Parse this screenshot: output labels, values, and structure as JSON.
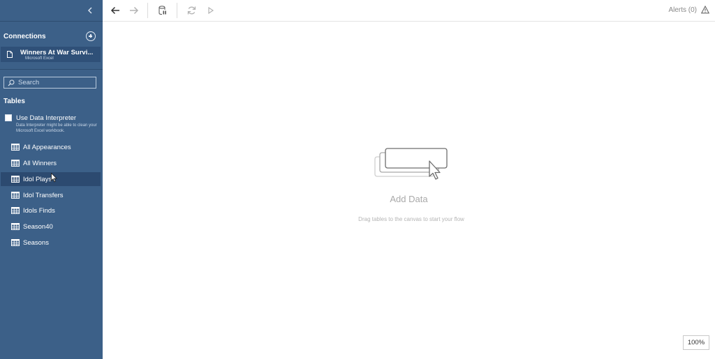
{
  "sidebar": {
    "collapse_icon": "chevron-left-icon",
    "connections_title": "Connections",
    "add_connection_icon": "plus-circle-icon",
    "connection": {
      "name": "Winners At War Survi...",
      "type": "Microsoft Excel"
    },
    "search": {
      "placeholder": "Search"
    },
    "tables_title": "Tables",
    "data_interpreter": {
      "label": "Use Data Interpreter",
      "checked": false,
      "hint": "Data Interpreter might be able to clean your Microsoft Excel workbook."
    },
    "tables": [
      {
        "label": "All Appearances"
      },
      {
        "label": "All Winners"
      },
      {
        "label": "Idol Plays"
      },
      {
        "label": "Idol Transfers"
      },
      {
        "label": "Idols Finds"
      },
      {
        "label": "Season40"
      },
      {
        "label": "Seasons"
      }
    ],
    "hovered_table": "Idol Plays"
  },
  "toolbar": {
    "buttons": [
      "back-arrow-icon",
      "forward-arrow-icon",
      "pause-data-icon",
      "refresh-icon",
      "run-icon"
    ],
    "alerts_label": "Alerts (0)",
    "alert_icon": "warning-icon"
  },
  "canvas": {
    "title": "Add Data",
    "subtitle": "Drag tables to the canvas to start your flow",
    "zoom": "100%"
  },
  "colors": {
    "sidebar_bg": "#3c6088",
    "sidebar_selected": "#2f5078",
    "canvas_text": "#a9a9a9"
  }
}
